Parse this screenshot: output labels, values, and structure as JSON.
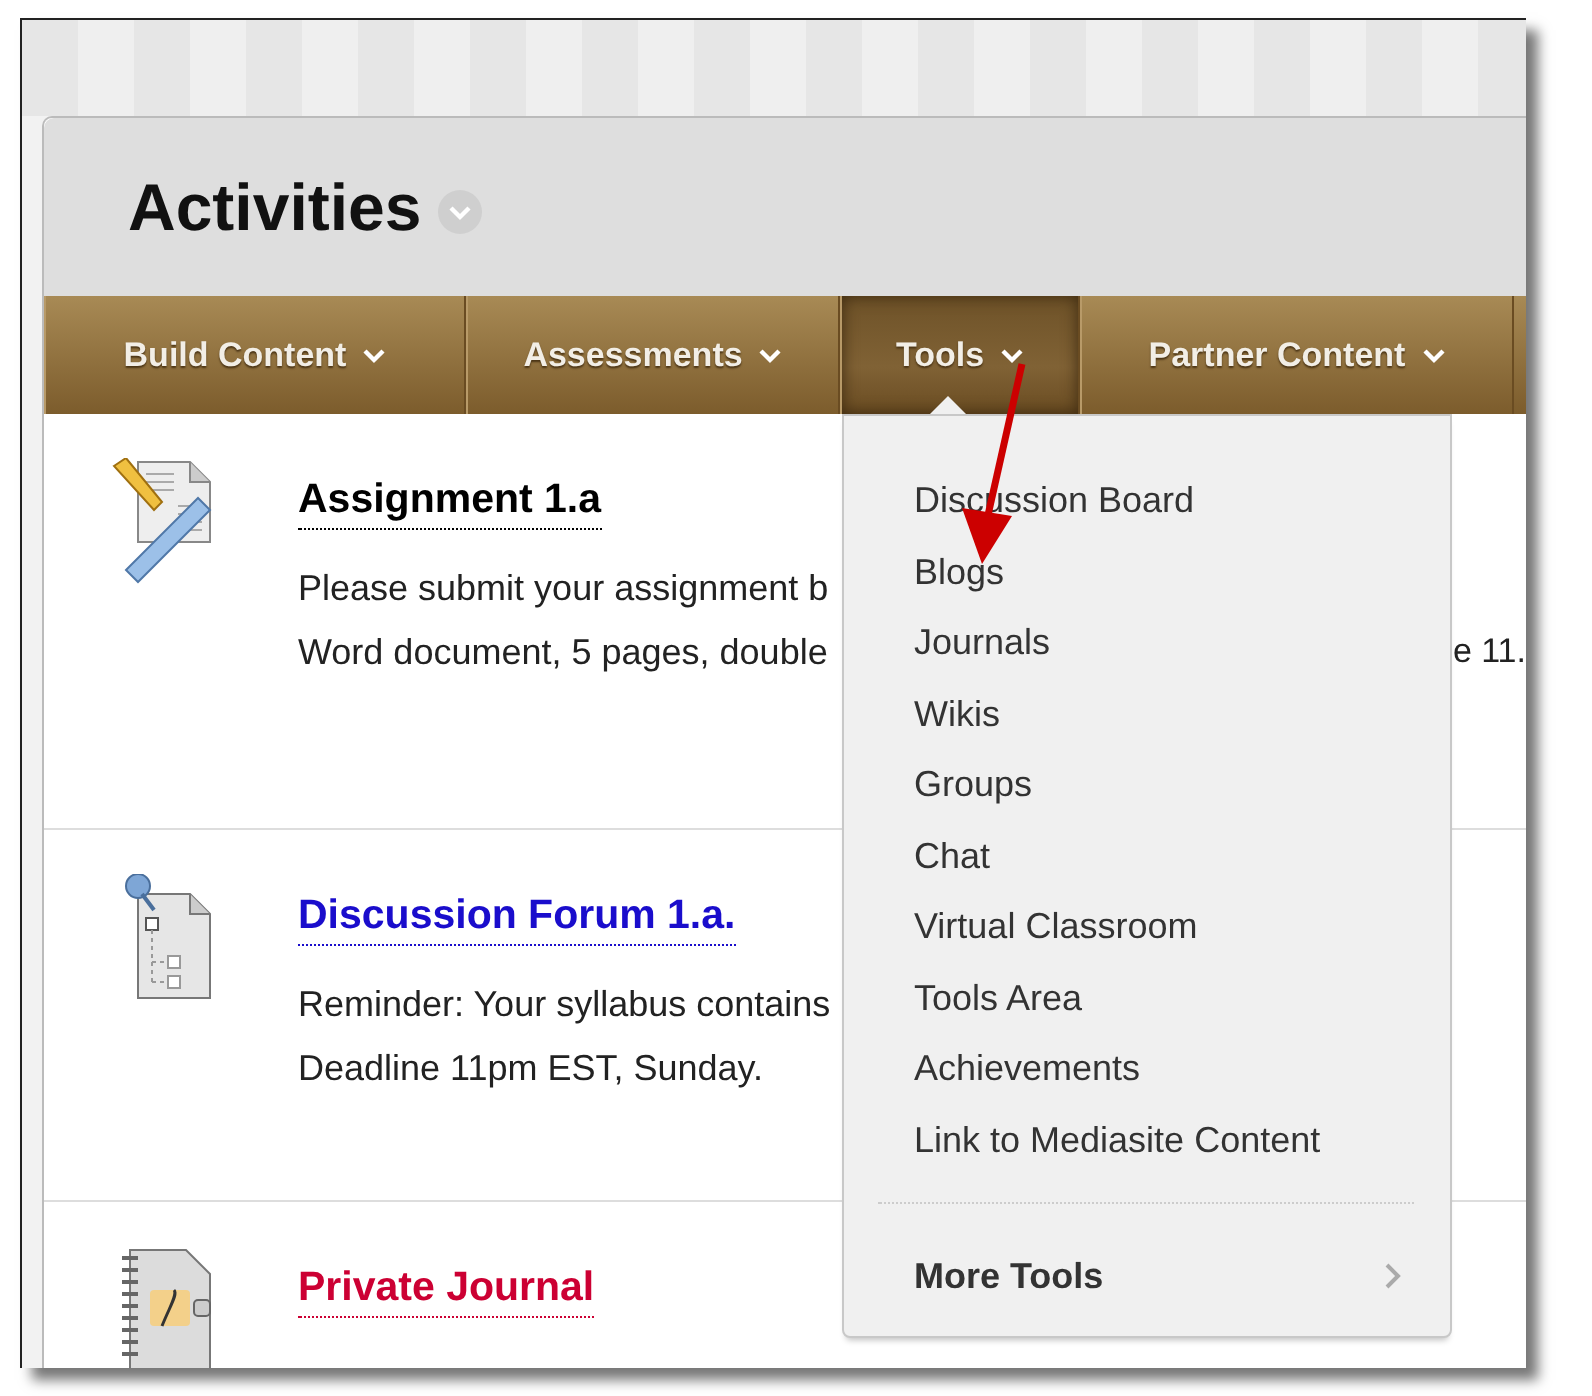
{
  "page": {
    "title": "Activities"
  },
  "tabs": [
    {
      "label": "Build Content",
      "selected": false
    },
    {
      "label": "Assessments",
      "selected": false
    },
    {
      "label": "Tools",
      "selected": true
    },
    {
      "label": "Partner Content",
      "selected": false
    }
  ],
  "content_items": [
    {
      "kind": "assignment",
      "title": "Assignment 1.a",
      "color": "#000000",
      "lines": [
        "Please submit your assignment b",
        "Word document, 5 pages, double"
      ],
      "peek": "e 11."
    },
    {
      "kind": "discussion",
      "title": "Discussion Forum 1.a.",
      "color": "#1a0dcc",
      "lines": [
        "Reminder: Your syllabus contains",
        "Deadline 11pm EST, Sunday."
      ]
    },
    {
      "kind": "journal",
      "title": "Private Journal",
      "color": "#cc0033"
    }
  ],
  "tools_menu": {
    "items": [
      "Discussion Board",
      "Blogs",
      "Journals",
      "Wikis",
      "Groups",
      "Chat",
      "Virtual Classroom",
      "Tools Area",
      "Achievements",
      "Link to Mediasite Content"
    ],
    "more_item": "More Tools"
  }
}
